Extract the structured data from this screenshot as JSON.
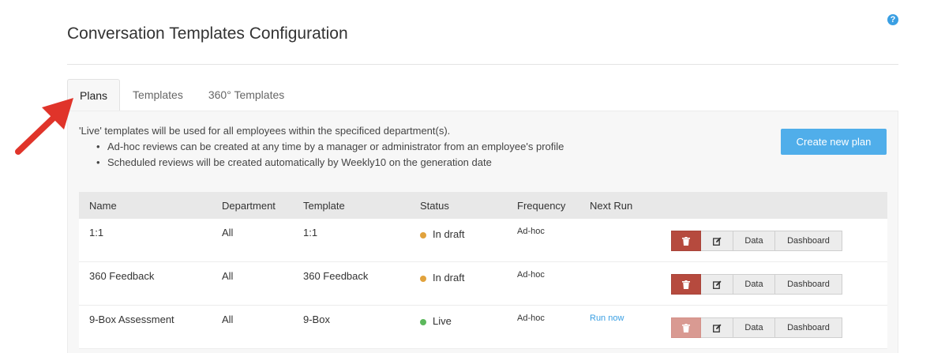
{
  "header": {
    "title": "Conversation Templates Configuration",
    "help_icon": "question-circle-icon",
    "help_glyph": "?"
  },
  "tabs": [
    {
      "label": "Plans",
      "active": true
    },
    {
      "label": "Templates",
      "active": false
    },
    {
      "label": "360° Templates",
      "active": false
    }
  ],
  "intro": {
    "line": "'Live' templates will be used for all employees within the specificed department(s).",
    "bullets": [
      "Ad-hoc reviews can be created at any time by a manager or administrator from an employee's profile",
      "Scheduled reviews will be created automatically by Weekly10 on the generation date"
    ]
  },
  "create_button": "Create new plan",
  "table": {
    "columns": [
      "Name",
      "Department",
      "Template",
      "Status",
      "Frequency",
      "Next Run"
    ],
    "rows": [
      {
        "name": "1:1",
        "department": "All",
        "template": "1:1",
        "status": "In draft",
        "status_color": "#e1a23c",
        "frequency": "Ad-hoc",
        "next_run": "",
        "delete_disabled": false
      },
      {
        "name": "360 Feedback",
        "department": "All",
        "template": "360 Feedback",
        "status": "In draft",
        "status_color": "#e1a23c",
        "frequency": "Ad-hoc",
        "next_run": "",
        "delete_disabled": false
      },
      {
        "name": "9-Box Assessment",
        "department": "All",
        "template": "9-Box",
        "status": "Live",
        "status_color": "#5cb85c",
        "frequency": "Ad-hoc",
        "next_run": "Run now",
        "delete_disabled": true
      }
    ],
    "actions": {
      "delete_icon": "trash-icon",
      "edit_icon": "edit-icon",
      "data_label": "Data",
      "dashboard_label": "Dashboard"
    }
  },
  "colors": {
    "accent": "#50aeea",
    "delete": "#b64a3e",
    "annotation_arrow": "#e0342a"
  }
}
